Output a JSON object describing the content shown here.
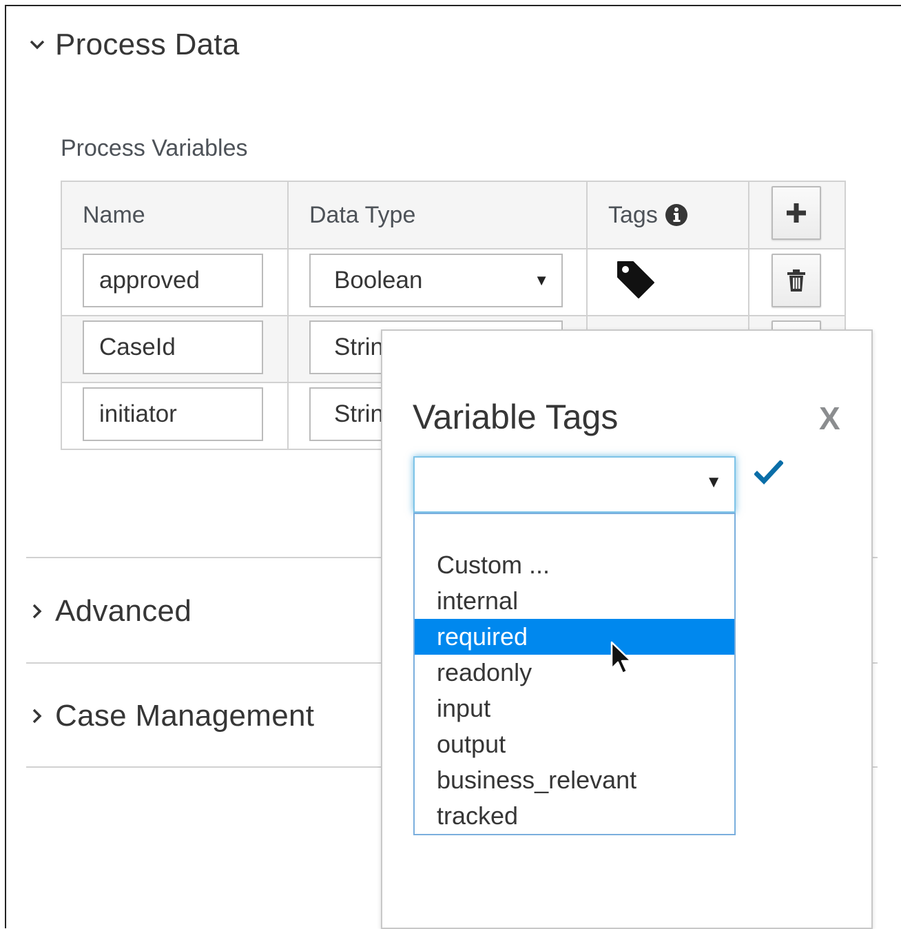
{
  "sections": {
    "process_data": "Process Data",
    "advanced": "Advanced",
    "case_management": "Case Management"
  },
  "process_variables": {
    "label": "Process Variables",
    "headers": {
      "name": "Name",
      "data_type": "Data Type",
      "tags": "Tags"
    },
    "rows": [
      {
        "name": "approved",
        "type": "Boolean"
      },
      {
        "name": "CaseId",
        "type": "String"
      },
      {
        "name": "initiator",
        "type": "String"
      }
    ]
  },
  "popover": {
    "title": "Variable Tags",
    "close": "X",
    "select_value": "",
    "options": [
      "Custom ...",
      "internal",
      "required",
      "readonly",
      "input",
      "output",
      "business_relevant",
      "tracked"
    ],
    "highlighted_option": "required"
  },
  "colors": {
    "accent": "#0088ee",
    "focus_border": "#7dc3e8",
    "check": "#0a6ea8"
  },
  "icons": {
    "expand": "chevron-down-icon",
    "collapse": "chevron-right-icon",
    "info": "info-circle-icon",
    "tag": "tag-icon",
    "add": "plus-icon",
    "delete": "trash-icon",
    "confirm": "checkmark-icon"
  }
}
